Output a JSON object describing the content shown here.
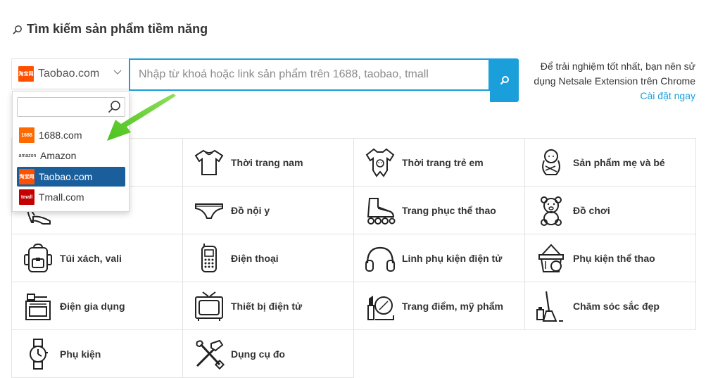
{
  "header": {
    "title": "Tìm kiếm sản phẩm tiềm năng",
    "title_icon": "search-icon"
  },
  "search": {
    "selected_source": "Taobao.com",
    "placeholder": "Nhập từ khoá hoặc link sản phẩm trên 1688, taobao, tmall",
    "value": ""
  },
  "note": {
    "text": "Để trải nghiệm tốt nhất, bạn nên sử dụng Netsale Extension trên Chrome",
    "link": "Cài đặt ngay"
  },
  "dropdown": {
    "search_value": "",
    "options": [
      {
        "label": "1688.com",
        "logo": "1688"
      },
      {
        "label": "Amazon",
        "logo": "amazon"
      },
      {
        "label": "Taobao.com",
        "logo": "淘宝网",
        "selected": true
      },
      {
        "label": "Tmall.com",
        "logo": "tmall"
      }
    ]
  },
  "categories": [
    {
      "label": "",
      "icon": "women-fashion-icon"
    },
    {
      "label": "Thời trang nam",
      "icon": "tshirt-icon"
    },
    {
      "label": "Thời trang trẻ em",
      "icon": "baby-clothes-icon"
    },
    {
      "label": "Sản phẩm mẹ và bé",
      "icon": "baby-icon"
    },
    {
      "label": "",
      "icon": "high-heel-icon"
    },
    {
      "label": "Đồ nội y",
      "icon": "underwear-icon"
    },
    {
      "label": "Trang phục thể thao",
      "icon": "roller-skate-icon"
    },
    {
      "label": "Đồ chơi",
      "icon": "teddy-bear-icon"
    },
    {
      "label": "Túi xách, vali",
      "icon": "backpack-icon"
    },
    {
      "label": "Điện thoại",
      "icon": "phone-icon"
    },
    {
      "label": "Linh phụ kiện điện tử",
      "icon": "headphones-icon"
    },
    {
      "label": "Phụ kiện thể thao",
      "icon": "sports-basket-icon"
    },
    {
      "label": "Điện gia dụng",
      "icon": "stove-icon"
    },
    {
      "label": "Thiết bị điện tử",
      "icon": "tv-icon"
    },
    {
      "label": "Trang điểm, mỹ phẩm",
      "icon": "makeup-icon"
    },
    {
      "label": "Chăm sóc sắc đẹp",
      "icon": "cleaning-icon"
    },
    {
      "label": "Phụ kiện",
      "icon": "watch-icon"
    },
    {
      "label": "Dụng cụ đo",
      "icon": "tools-icon"
    }
  ],
  "colors": {
    "accent": "#1a9fdb",
    "selected_option": "#1a5f9c",
    "arrow": "#5ccb2b"
  }
}
